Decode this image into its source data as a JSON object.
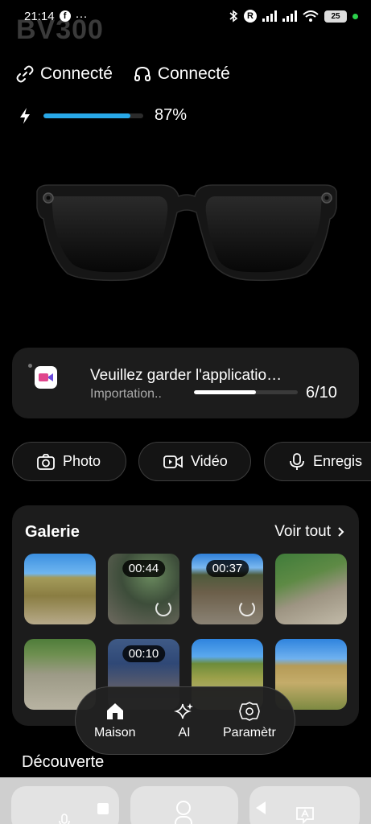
{
  "status_bar": {
    "time": "21:14",
    "fb_letter": "f",
    "more": "···",
    "r_letter": "R",
    "battery": "25"
  },
  "device": {
    "name": "BV300"
  },
  "connection": {
    "link_status": "Connecté",
    "audio_status": "Connecté"
  },
  "battery": {
    "level": 0.87,
    "label": "87%"
  },
  "import": {
    "title": "Veuillez garder l'applicatio…",
    "subtitle": "Importation..",
    "progress": 0.6,
    "count": "6/10"
  },
  "actions": [
    {
      "label": "Photo"
    },
    {
      "label": "Vidéo"
    },
    {
      "label": "Enregis"
    }
  ],
  "gallery": {
    "title": "Galerie",
    "see_all": "Voir tout",
    "items": [
      {
        "type": "photo",
        "duration": ""
      },
      {
        "type": "video",
        "duration": "00:44"
      },
      {
        "type": "video",
        "duration": "00:37"
      },
      {
        "type": "photo",
        "duration": ""
      },
      {
        "type": "photo",
        "duration": ""
      },
      {
        "type": "video",
        "duration": "00:10"
      },
      {
        "type": "photo",
        "duration": ""
      },
      {
        "type": "photo",
        "duration": ""
      }
    ]
  },
  "bottom_nav": [
    {
      "label": "Maison",
      "icon": "home-icon",
      "active": true
    },
    {
      "label": "AI",
      "icon": "sparkle-icon",
      "active": false
    },
    {
      "label": "Paramètr",
      "icon": "gear-icon",
      "active": false
    }
  ],
  "discover": {
    "title": "Découverte"
  },
  "colors": {
    "accent": "#28a8e8",
    "card": "#1c1c1c",
    "background": "#000000"
  }
}
